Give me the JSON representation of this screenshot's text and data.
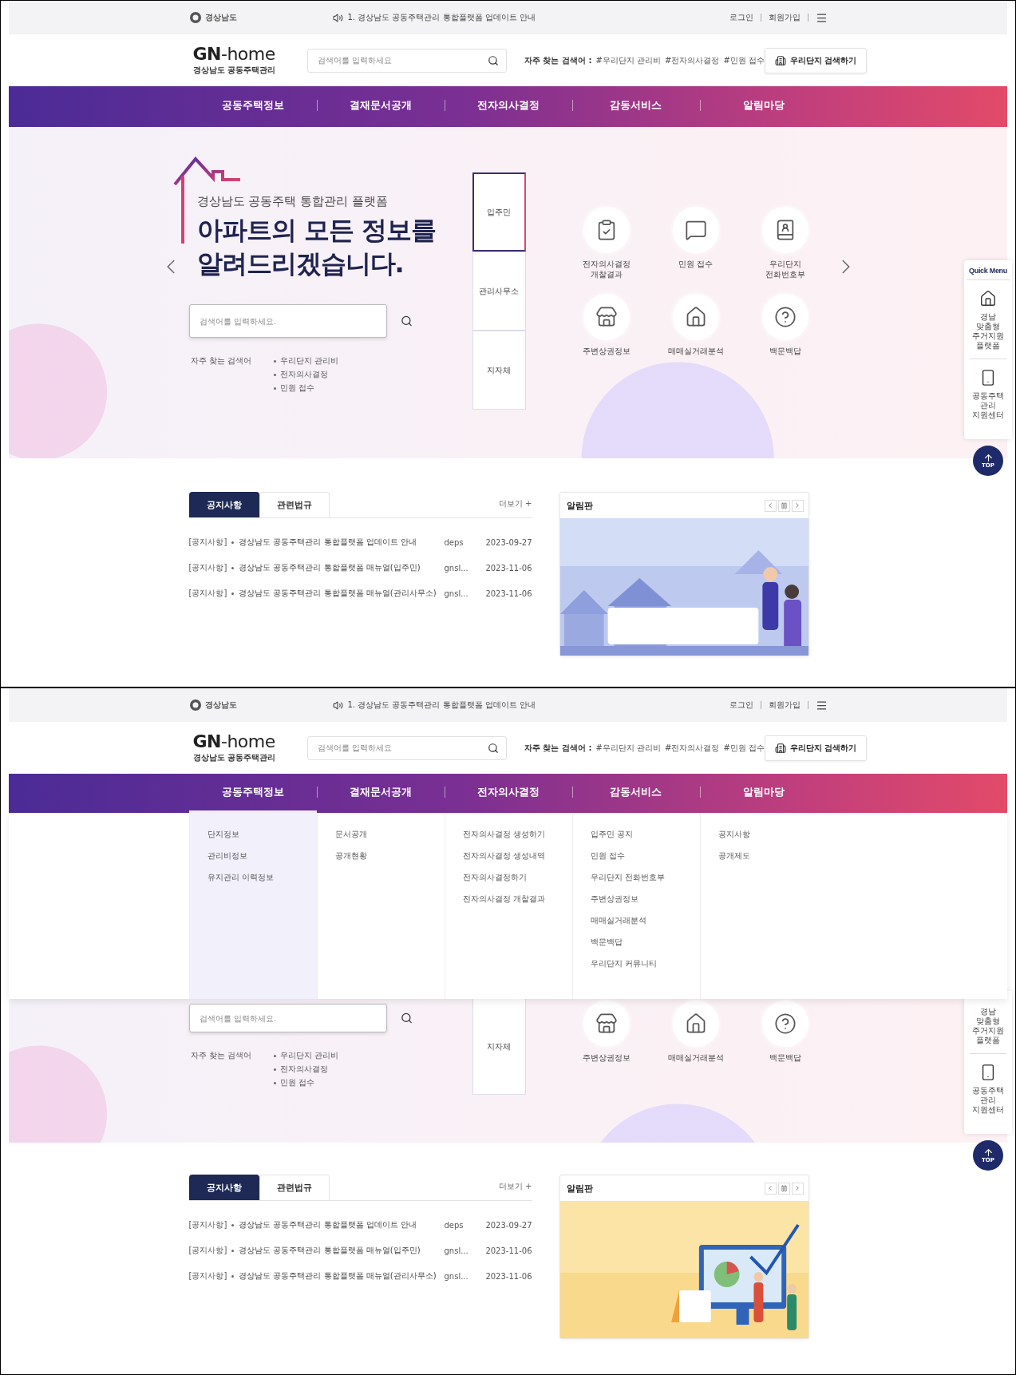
{
  "screens": [
    {
      "top_bar": {
        "org": "경상남도",
        "notice": "1. 경상남도 공동주택관리 통합플랫폼 업데이트 안내",
        "links": [
          "로그인",
          "회원가입"
        ]
      },
      "header": {
        "logo_title": "**GN**-home",
        "logo_subtitle": "경상남도 공동주택관리",
        "search_placeholder": "검색어를 입력하세요",
        "popular_label": "자주 찾는 검색어 :",
        "popular_tags": [
          "#우리단지 관리비",
          "#전자의사결정",
          "#민원 접수"
        ],
        "button": "우리단지 검색하기"
      },
      "nav": [
        {
          "label": "공동주택정보",
          "selected": false
        },
        {
          "label": "결재문서공개",
          "selected": false
        },
        {
          "label": "전자의사결정",
          "selected": false
        },
        {
          "label": "감동서비스",
          "selected": false
        },
        {
          "label": "알림마당",
          "selected": false
        }
      ],
      "hero": {
        "kind": "full",
        "subtitle": "경상남도 공동주택 통합관리 플랫폼",
        "headline": [
          "아파트의 모든 정보를",
          "알려드리겠습니다."
        ],
        "search_placeholder": "검색어를 입력하세요.",
        "popular_label": "자주 찾는 검색어",
        "popular_items": [
          "우리단지 관리비",
          "전자의사결정",
          "민원 접수"
        ],
        "tabs": [
          {
            "label": "입주민",
            "selected": true
          },
          {
            "label": "관리사무소",
            "selected": false
          },
          {
            "label": "지자체",
            "selected": false
          }
        ],
        "services": [
          {
            "label": "전자의사결정 개찰결과",
            "kind": "vote"
          },
          {
            "label": "민원 접수",
            "kind": "complaint"
          },
          {
            "label": "우리단지 전화번호부",
            "kind": "phonebook"
          },
          {
            "label": "주변상권정보",
            "kind": "commerce"
          },
          {
            "label": "매매실거래분석",
            "kind": "trade"
          },
          {
            "label": "백문백답",
            "kind": "faq"
          }
        ],
        "quick_menu": {
          "title": "Quick Menu",
          "items": [
            {
              "label": "경남 맞춤형 주거지원 플랫폼",
              "kind": "housing"
            },
            {
              "label": "공동주택 관리 지원센터",
              "kind": "support"
            }
          ],
          "top": "TOP"
        }
      },
      "notices": {
        "tabs": [
          {
            "label": "공지사항",
            "selected": true
          },
          {
            "label": "관련법규",
            "selected": false
          }
        ],
        "more": "더보기 +",
        "rows": [
          {
            "category": "[공지사항]",
            "title": "경상남도 공동주택관리 통합플랫폼 업데이트 안내",
            "author": "deps",
            "date": "2023-09-27"
          },
          {
            "category": "[공지사항]",
            "title": "경상남도 공동주택관리 통합플랫폼 매뉴얼(입주민)",
            "author": "gnsl...",
            "date": "2023-11-06"
          },
          {
            "category": "[공지사항]",
            "title": "경상남도 공동주택관리 통합플랫폼 매뉴얼(관리사무소)",
            "author": "gnsl...",
            "date": "2023-11-06"
          }
        ]
      },
      "board": {
        "title": "알림판"
      }
    },
    {
      "top_bar": {
        "org": "경상남도",
        "notice": "1. 경상남도 공동주택관리 통합플랫폼 업데이트 안내",
        "links": [
          "로그인",
          "회원가입"
        ]
      },
      "header": {
        "logo_title": "**GN**-home",
        "logo_subtitle": "경상남도 공동주택관리",
        "search_placeholder": "검색어를 입력하세요",
        "popular_label": "자주 찾는 검색어 :",
        "popular_tags": [
          "#우리단지 관리비",
          "#전자의사결정",
          "#민원 접수"
        ],
        "button": "우리단지 검색하기"
      },
      "nav": [
        {
          "label": "공동주택정보",
          "selected": true
        },
        {
          "label": "결재문서공개",
          "selected": false
        },
        {
          "label": "전자의사결정",
          "selected": false
        },
        {
          "label": "감동서비스",
          "selected": false
        },
        {
          "label": "알림마당",
          "selected": false
        }
      ],
      "mega_menu": {
        "columns": [
          {
            "items": [
              "단지정보",
              "관리비정보",
              "유지관리 이력정보"
            ]
          },
          {
            "items": [
              "문서공개",
              "공개현황"
            ]
          },
          {
            "items": [
              "전자의사결정 생성하기",
              "전자의사결정 생성내역",
              "전자의사결정하기",
              "전자의사결정 개찰결과"
            ]
          },
          {
            "items": [
              "입주민 공지",
              "민원 접수",
              "우리단지 전화번호부",
              "주변상권정보",
              "매매실거래분석",
              "백문백답",
              "우리단지 커뮤니티"
            ]
          },
          {
            "items": [
              "공지사항",
              "공개제도"
            ]
          }
        ]
      },
      "hero": {
        "kind": "partial",
        "search_placeholder": "검색어를 입력하세요.",
        "popular_label": "자주 찾는 검색어",
        "popular_items": [
          "우리단지 관리비",
          "전자의사결정",
          "민원 접수"
        ],
        "tabs": [
          {
            "label": "지자체",
            "selected": false
          }
        ],
        "services": [
          {
            "label": "주변상권정보",
            "kind": "commerce"
          },
          {
            "label": "매매실거래분석",
            "kind": "trade"
          },
          {
            "label": "백문백답",
            "kind": "faq"
          }
        ],
        "quick_menu": {
          "items": [
            {
              "label": "경남 맞춤형 주거지원 플랫폼"
            },
            {
              "label": "공동주택 관리 지원센터",
              "kind": "support"
            }
          ],
          "top": "TOP"
        }
      },
      "notices": {
        "tabs": [
          {
            "label": "공지사항",
            "selected": true
          },
          {
            "label": "관련법규",
            "selected": false
          }
        ],
        "more": "더보기 +",
        "rows": [
          {
            "category": "[공지사항]",
            "title": "경상남도 공동주택관리 통합플랫폼 업데이트 안내",
            "author": "deps",
            "date": "2023-09-27"
          },
          {
            "category": "[공지사항]",
            "title": "경상남도 공동주택관리 통합플랫폼 매뉴얼(입주민)",
            "author": "gnsl...",
            "date": "2023-11-06"
          },
          {
            "category": "[공지사항]",
            "title": "경상남도 공동주택관리 통합플랫폼 매뉴얼(관리사무소)",
            "author": "gnsl...",
            "date": "2023-11-06"
          }
        ]
      },
      "board": {
        "title": "알림판"
      }
    }
  ]
}
